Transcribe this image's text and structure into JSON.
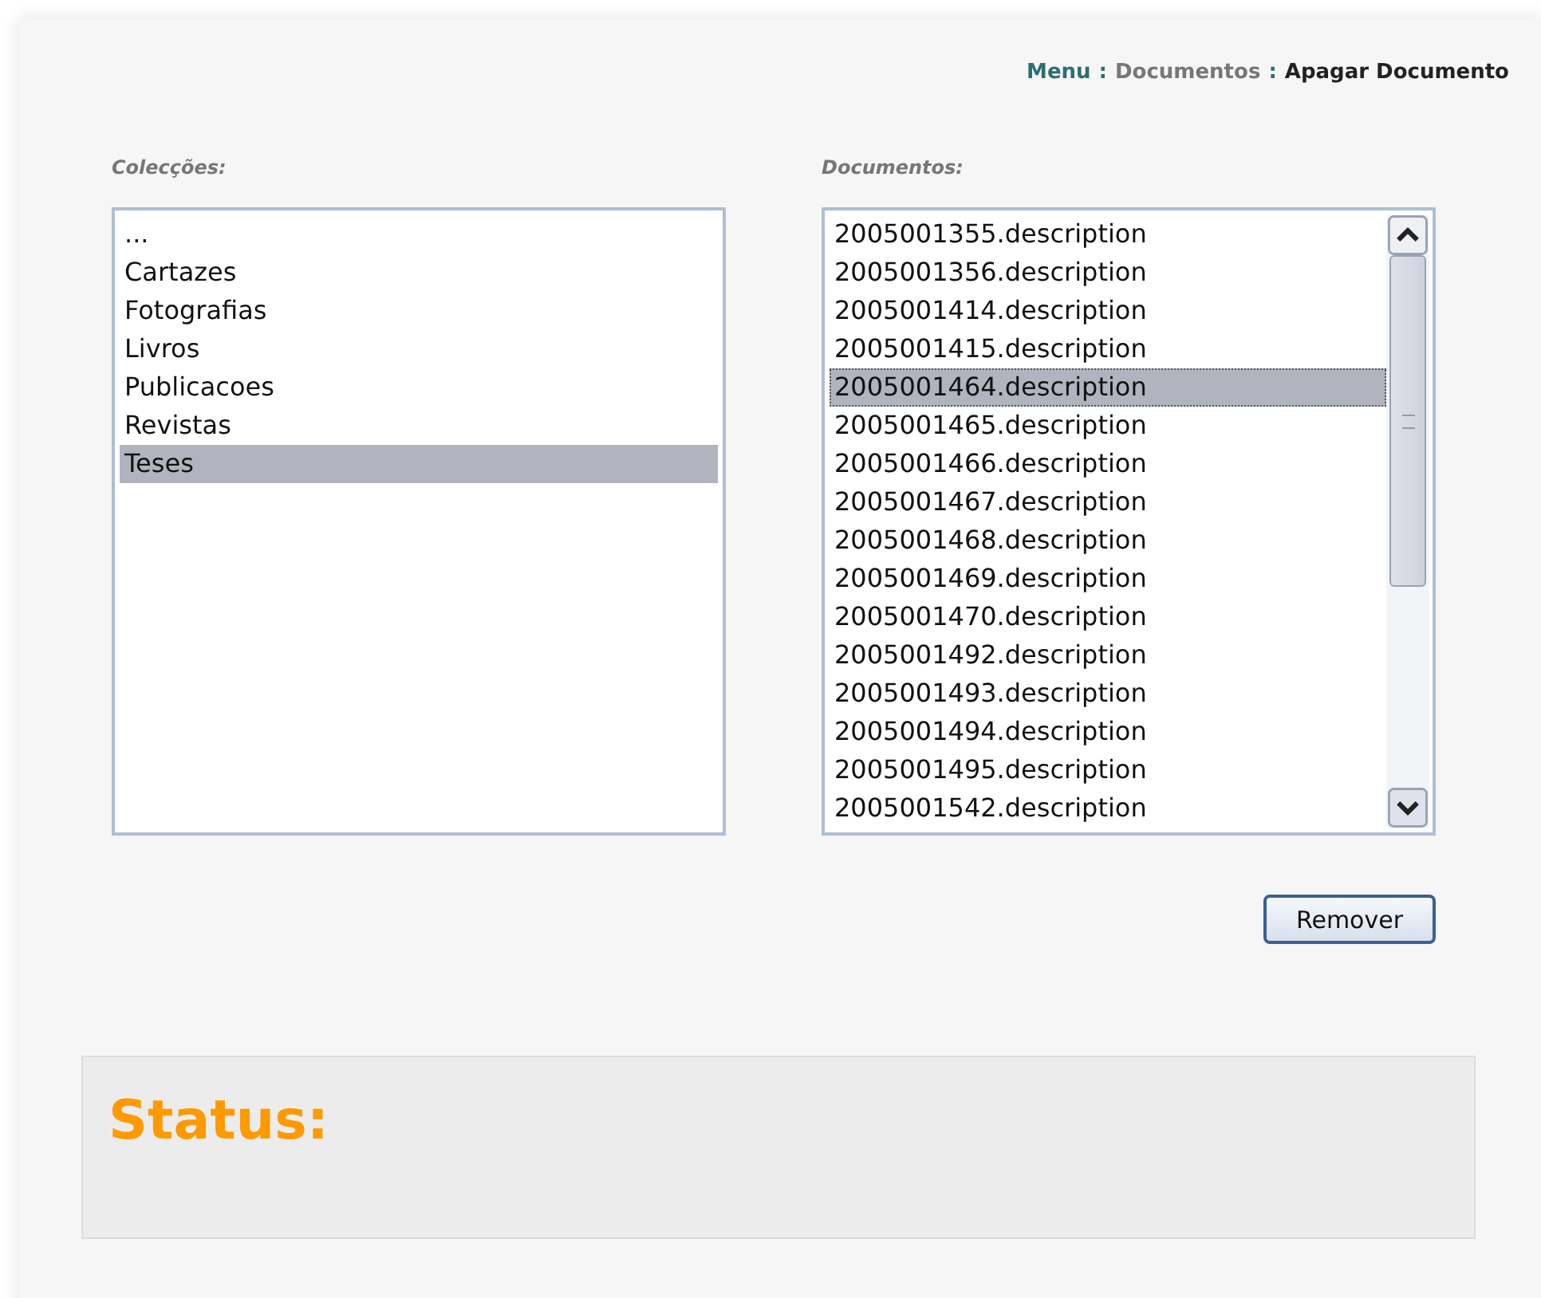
{
  "breadcrumb": {
    "separator": ":",
    "items": [
      {
        "label": "Menu",
        "kind": "root"
      },
      {
        "label": "Documentos",
        "kind": "link"
      },
      {
        "label": "Apagar Documento",
        "kind": "current"
      }
    ]
  },
  "collections": {
    "label": "Colecções:",
    "items": [
      {
        "label": "...",
        "selected": false
      },
      {
        "label": "Cartazes",
        "selected": false
      },
      {
        "label": "Fotografias",
        "selected": false
      },
      {
        "label": "Livros",
        "selected": false
      },
      {
        "label": "Publicacoes",
        "selected": false
      },
      {
        "label": "Revistas",
        "selected": false
      },
      {
        "label": "Teses",
        "selected": true
      }
    ]
  },
  "documents": {
    "label": "Documentos:",
    "items": [
      {
        "label": "2005001355.description",
        "selected": false
      },
      {
        "label": "2005001356.description",
        "selected": false
      },
      {
        "label": "2005001414.description",
        "selected": false
      },
      {
        "label": "2005001415.description",
        "selected": false
      },
      {
        "label": "2005001464.description",
        "selected": true
      },
      {
        "label": "2005001465.description",
        "selected": false
      },
      {
        "label": "2005001466.description",
        "selected": false
      },
      {
        "label": "2005001467.description",
        "selected": false
      },
      {
        "label": "2005001468.description",
        "selected": false
      },
      {
        "label": "2005001469.description",
        "selected": false
      },
      {
        "label": "2005001470.description",
        "selected": false
      },
      {
        "label": "2005001492.description",
        "selected": false
      },
      {
        "label": "2005001493.description",
        "selected": false
      },
      {
        "label": "2005001494.description",
        "selected": false
      },
      {
        "label": "2005001495.description",
        "selected": false
      },
      {
        "label": "2005001542.description",
        "selected": false
      }
    ]
  },
  "remove_button": "Remover",
  "status": {
    "label": "Status:"
  }
}
